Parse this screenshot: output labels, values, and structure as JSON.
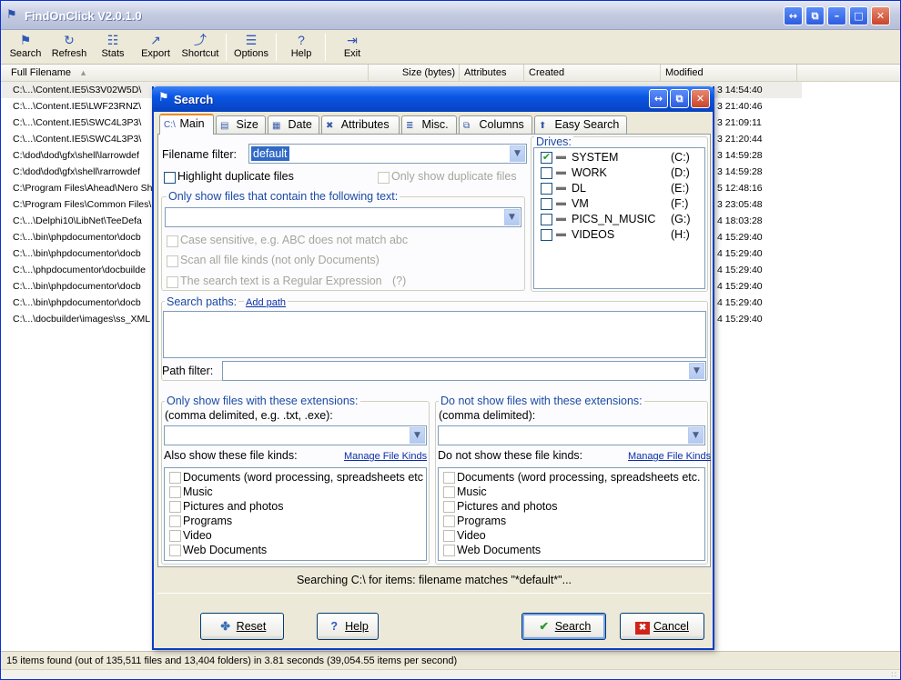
{
  "main": {
    "title": "FindOnClick V2.0.1.0",
    "window_buttons": [
      "↔",
      "⧉",
      "–",
      "□",
      "✕"
    ],
    "toolbar": [
      {
        "name": "search",
        "label": "Search",
        "icon": "magnifier-icon",
        "glyph": "⚑"
      },
      {
        "name": "refresh",
        "label": "Refresh",
        "icon": "refresh-icon",
        "glyph": "↻"
      },
      {
        "name": "stats",
        "label": "Stats",
        "icon": "stats-icon",
        "glyph": "☷"
      },
      {
        "name": "export",
        "label": "Export",
        "icon": "export-icon",
        "glyph": "↗"
      },
      {
        "name": "shortcut",
        "label": "Shortcut",
        "icon": "shortcut-icon",
        "glyph": "⤴"
      },
      {
        "name": "options",
        "label": "Options",
        "icon": "options-icon",
        "glyph": "☰"
      },
      {
        "name": "help",
        "label": "Help",
        "icon": "help-icon",
        "glyph": "?"
      },
      {
        "name": "exit",
        "label": "Exit",
        "icon": "exit-icon",
        "glyph": "⇥"
      }
    ],
    "columns": [
      "Full Filename",
      "Size (bytes)",
      "Attributes",
      "Created",
      "Modified"
    ],
    "sort_glyph": "▲",
    "rows": [
      {
        "filename": "C:\\...\\Content.IE5\\S3V02W5D\\",
        "modified": "3 14:54:40"
      },
      {
        "filename": "C:\\...\\Content.IE5\\LWF23RNZ\\",
        "modified": "3 21:40:46"
      },
      {
        "filename": "C:\\...\\Content.IE5\\SWC4L3P3\\",
        "modified": "3 21:09:11"
      },
      {
        "filename": "C:\\...\\Content.IE5\\SWC4L3P3\\",
        "modified": "3 21:20:44"
      },
      {
        "filename": "C:\\dod\\dod\\gfx\\shell\\larrowdef",
        "modified": "3 14:59:28"
      },
      {
        "filename": "C:\\dod\\dod\\gfx\\shell\\rarrowdef",
        "modified": "3 14:59:28"
      },
      {
        "filename": "C:\\Program Files\\Ahead\\Nero Sh",
        "modified": "5 12:48:16"
      },
      {
        "filename": "C:\\Program Files\\Common Files\\",
        "modified": "3 23:05:48"
      },
      {
        "filename": "C:\\...\\Delphi10\\LibNet\\TeeDefa",
        "modified": "4 18:03:28"
      },
      {
        "filename": "C:\\...\\bin\\phpdocumentor\\docb",
        "modified": "4 15:29:40"
      },
      {
        "filename": "C:\\...\\bin\\phpdocumentor\\docb",
        "modified": "4 15:29:40"
      },
      {
        "filename": "C:\\...\\phpdocumentor\\docbuilde",
        "modified": "4 15:29:40"
      },
      {
        "filename": "C:\\...\\bin\\phpdocumentor\\docb",
        "modified": "4 15:29:40"
      },
      {
        "filename": "C:\\...\\bin\\phpdocumentor\\docb",
        "modified": "4 15:29:40"
      },
      {
        "filename": "C:\\...\\docbuilder\\images\\ss_XML",
        "modified": "4 15:29:40"
      }
    ],
    "status": "15 items found (out of 135,511 files and 13,404 folders) in 3.81 seconds (39,054.55 items per second)"
  },
  "dialog": {
    "title": "Search",
    "window_buttons": [
      "↔",
      "⧉",
      "✕"
    ],
    "tabs": [
      {
        "label": "Main",
        "icon": "C:\\"
      },
      {
        "label": "Size",
        "icon": "▤"
      },
      {
        "label": "Date",
        "icon": "▦"
      },
      {
        "label": "Attributes",
        "icon": "✖"
      },
      {
        "label": "Misc.",
        "icon": "≣"
      },
      {
        "label": "Columns",
        "icon": "⧉"
      },
      {
        "label": "Easy Search",
        "icon": "⬆"
      }
    ],
    "filename_filter_label": "Filename filter:",
    "filename_filter_value": "default",
    "highlight_duplicates": "Highlight duplicate files",
    "only_duplicates": "Only show duplicate files",
    "text_group_label": "Only show files that contain the following text:",
    "case_sensitive": "Case sensitive, e.g. ABC does not match abc",
    "scan_all": "Scan all file kinds (not only Documents)",
    "regex": "The search text is a Regular Expression",
    "regex_help": "(?)",
    "drives_label": "Drives:",
    "drives": [
      {
        "name": "SYSTEM",
        "letter": "(C:)",
        "checked": true
      },
      {
        "name": "WORK",
        "letter": "(D:)",
        "checked": false
      },
      {
        "name": "DL",
        "letter": "(E:)",
        "checked": false
      },
      {
        "name": "VM",
        "letter": "(F:)",
        "checked": false
      },
      {
        "name": "PICS_N_MUSIC",
        "letter": "(G:)",
        "checked": false
      },
      {
        "name": "VIDEOS",
        "letter": "(H:)",
        "checked": false
      }
    ],
    "search_paths_label": "Search paths:",
    "add_path": "Add path",
    "path_filter_label": "Path filter:",
    "include_ext_label": "Only show files with these extensions:",
    "include_ext_hint": "(comma delimited, e.g. .txt, .exe):",
    "also_show_label": "Also show these file kinds:",
    "manage_kinds": "Manage File Kinds",
    "exclude_ext_label": "Do not show files with these extensions:",
    "exclude_ext_hint": "(comma delimited):",
    "do_not_show_label": "Do not show these file kinds:",
    "kinds_left": [
      "Documents (word processing, spreadsheets etc",
      "Music",
      "Pictures and photos",
      "Programs",
      "Video",
      "Web Documents"
    ],
    "kinds_right": [
      "Documents (word processing, spreadsheets etc.",
      "Music",
      "Pictures and photos",
      "Programs",
      "Video",
      "Web Documents"
    ],
    "search_summary": "Searching C:\\ for items: filename matches \"*default*\"...",
    "buttons": {
      "reset": "Reset",
      "help": "Help",
      "search": "Search",
      "cancel": "Cancel"
    },
    "button_glyphs": {
      "reset": "✤",
      "help": "?",
      "search": "✔",
      "cancel": "✖"
    },
    "checkmark": "✔",
    "dropdown_glyph": "▼"
  }
}
